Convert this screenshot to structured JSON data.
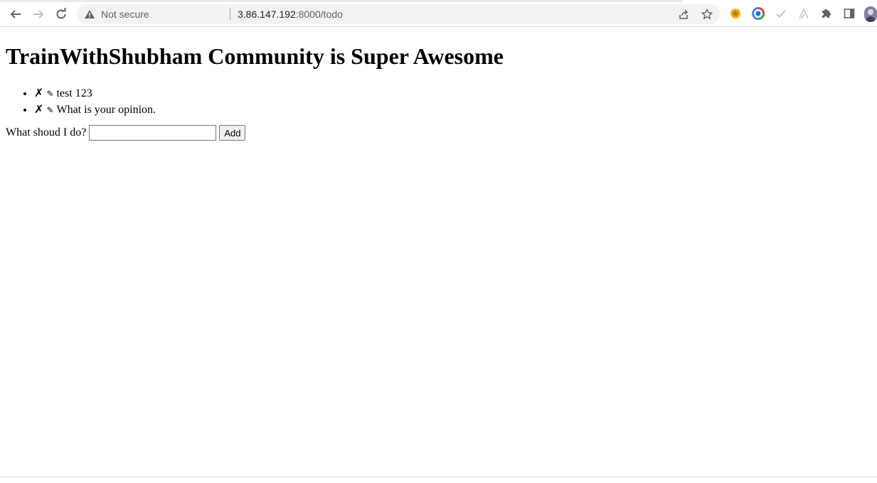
{
  "browser": {
    "security_label": "Not secure",
    "url_host": "3.86.147.192",
    "url_path": ":8000/todo",
    "icons": {
      "back": "arrow-left-icon",
      "forward": "arrow-right-icon",
      "reload": "reload-icon",
      "warning": "warning-triangle-icon",
      "share": "share-icon",
      "bookmark": "star-icon",
      "extensions": "puzzle-icon",
      "side_panel": "side-panel-icon"
    }
  },
  "page": {
    "title": "TrainWithShubham Community is Super Awesome",
    "todos": [
      {
        "delete_glyph": "✗",
        "edit_glyph": "✎",
        "text": "test 123"
      },
      {
        "delete_glyph": "✗",
        "edit_glyph": "✎",
        "text": "What is your opinion."
      }
    ],
    "form": {
      "label": "What shoud I do?",
      "input_value": "",
      "button_label": "Add"
    }
  }
}
